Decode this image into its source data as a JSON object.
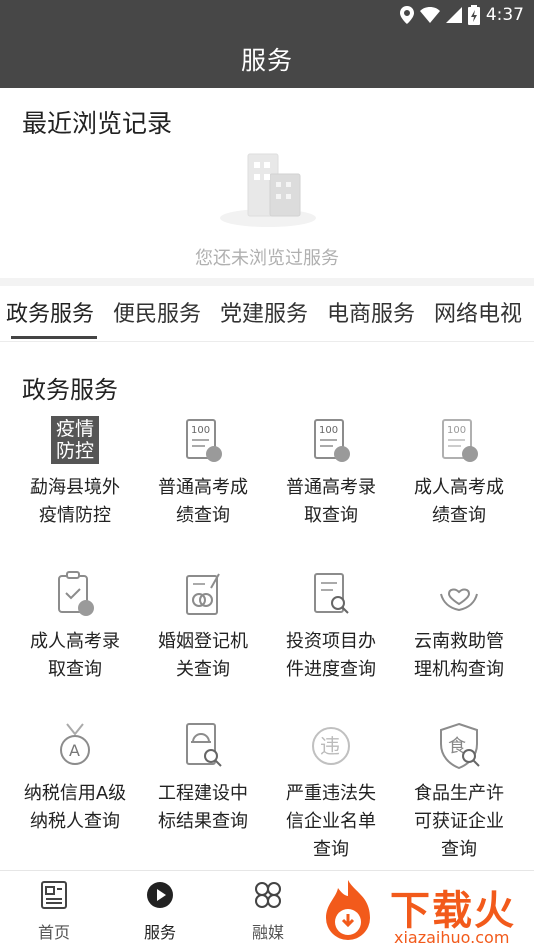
{
  "status": {
    "time": "4:37"
  },
  "header": {
    "title": "服务"
  },
  "recent": {
    "title": "最近浏览记录",
    "empty_text": "您还未浏览过服务"
  },
  "tabs": [
    {
      "label": "政务服务",
      "active": true
    },
    {
      "label": "便民服务"
    },
    {
      "label": "党建服务"
    },
    {
      "label": "电商服务"
    },
    {
      "label": "网络电视"
    }
  ],
  "section": {
    "title": "政务服务"
  },
  "services": [
    {
      "label": "勐海县境外疫情防控",
      "icon": "covid-control-icon",
      "badge_line1": "疫情",
      "badge_line2": "防控"
    },
    {
      "label": "普通高考成绩查询",
      "icon": "exam-score-icon"
    },
    {
      "label": "普通高考录取查询",
      "icon": "exam-admission-icon"
    },
    {
      "label": "成人高考成绩查询",
      "icon": "adult-exam-score-icon"
    },
    {
      "label": "成人高考录取查询",
      "icon": "adult-exam-admission-icon"
    },
    {
      "label": "婚姻登记机关查询",
      "icon": "marriage-registry-icon"
    },
    {
      "label": "投资项目办件进度查询",
      "icon": "investment-progress-icon"
    },
    {
      "label": "云南救助管理机构查询",
      "icon": "rescue-agency-icon"
    },
    {
      "label": "纳税信用A级纳税人查询",
      "icon": "tax-credit-icon"
    },
    {
      "label": "工程建设中标结果查询",
      "icon": "construction-bid-icon"
    },
    {
      "label": "严重违法失信企业名单查询",
      "icon": "illegal-enterprise-icon"
    },
    {
      "label": "食品生产许可获证企业查询",
      "icon": "food-license-icon"
    }
  ],
  "bottom_nav": [
    {
      "label": "首页",
      "icon": "home-icon"
    },
    {
      "label": "服务",
      "icon": "service-icon",
      "active": true
    },
    {
      "label": "融媒",
      "icon": "media-icon"
    }
  ],
  "watermark": {
    "title": "下载火",
    "sub": "xiazaihuo.com"
  },
  "colors": {
    "header_bg": "#474747",
    "icon_gray": "#8c8c8c",
    "watermark": "#f25a1b"
  }
}
